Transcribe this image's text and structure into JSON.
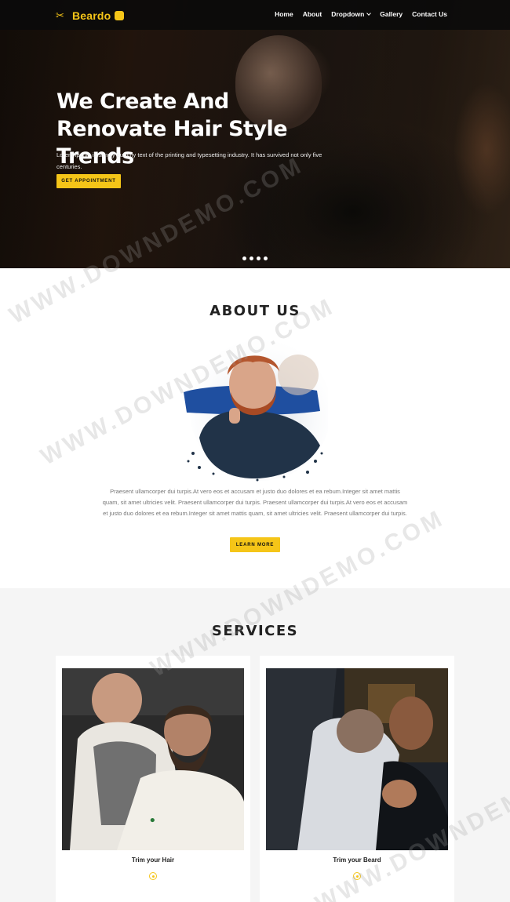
{
  "brand": {
    "name": "Beardo",
    "icon": "scissors-icon"
  },
  "nav": {
    "items": [
      {
        "label": "Home"
      },
      {
        "label": "About"
      },
      {
        "label": "Dropdown",
        "has_dropdown": true
      },
      {
        "label": "Gallery"
      },
      {
        "label": "Contact Us"
      }
    ]
  },
  "hero": {
    "title": "We Create And Renovate Hair Style Trends",
    "text": "Lorem Ipsum is simply dummy text of the printing and typesetting industry. It has survived not only five centuries.",
    "button_label": "GET APPOINTMENT",
    "slides": 4,
    "active_slide": 1
  },
  "about": {
    "title": "ABOUT US",
    "body": "Praesent ullamcorper dui turpis.At vero eos et accusam et justo duo dolores et ea rebum.Integer sit amet mattis quam, sit amet ultricies velit. Praesent ullamcorper dui turpis. Praesent ullamcorper dui turpis.At vero eos et accusam et justo duo dolores et ea rebum.Integer sit amet mattis quam, sit amet ultricies velit. Praesent ullamcorper dui turpis.",
    "button_label": "LEARN MORE"
  },
  "services": {
    "title": "SERVICES",
    "cards": [
      {
        "label": "Trim your Hair",
        "icon": "circle-dot-icon"
      },
      {
        "label": "Trim your Beard",
        "icon": "circle-dot-icon"
      }
    ]
  },
  "watermark": "WWW.DOWNDEMO.COM",
  "colors": {
    "accent": "#f5c518",
    "dark": "#0f0f0f",
    "section_gray": "#f5f5f5"
  }
}
